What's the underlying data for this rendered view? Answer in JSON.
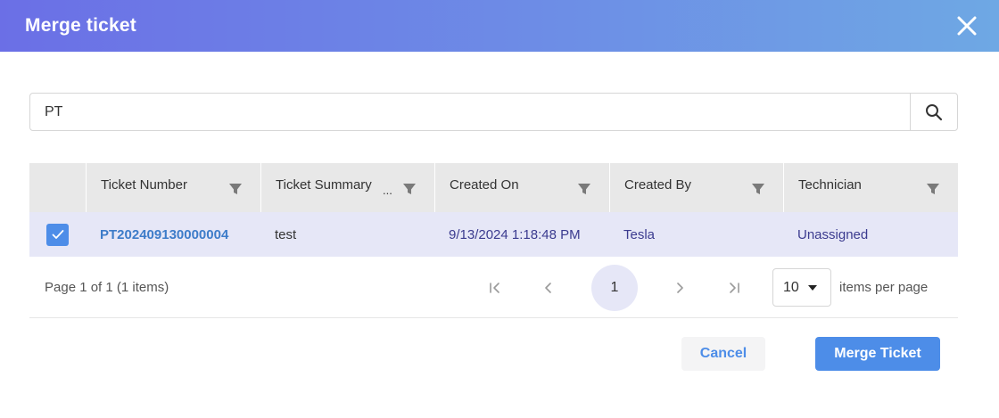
{
  "dialog": {
    "title": "Merge ticket"
  },
  "search": {
    "value": "PT",
    "placeholder": ""
  },
  "table": {
    "columns": [
      {
        "label": "Ticket Number"
      },
      {
        "label": "Ticket Summary",
        "truncated_marker": "..."
      },
      {
        "label": "Created On"
      },
      {
        "label": "Created By"
      },
      {
        "label": "Technician"
      }
    ],
    "rows": [
      {
        "selected": true,
        "ticket_number": "PT202409130000004",
        "summary": "test",
        "created_on": "9/13/2024 1:18:48 PM",
        "created_by": "Tesla",
        "technician": "Unassigned"
      }
    ]
  },
  "pager": {
    "info": "Page 1 of 1 (1 items)",
    "current_page": "1",
    "page_size": "10",
    "per_page_label": "items per page"
  },
  "footer": {
    "cancel_label": "Cancel",
    "merge_label": "Merge Ticket"
  },
  "colors": {
    "header_gradient_start": "#6b6fe6",
    "header_gradient_end": "#6ea8e4",
    "accent": "#4d8de8",
    "selected_row": "#e6e7f7",
    "link": "#3d7cc9"
  },
  "icons": {
    "close": "close-icon",
    "search": "search-icon",
    "filter": "filter-icon",
    "check": "check-icon",
    "first": "first-page-icon",
    "prev": "prev-page-icon",
    "next": "next-page-icon",
    "last": "last-page-icon",
    "caret": "caret-down-icon"
  }
}
